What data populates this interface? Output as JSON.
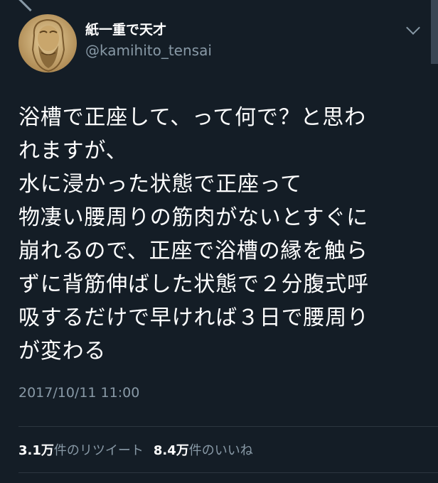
{
  "colors": {
    "background": "#141d26",
    "text_primary": "#ffffff",
    "text_secondary": "#8899a6",
    "divider": "#2c3640"
  },
  "icons": {
    "back": "chevron-left-icon",
    "more": "chevron-down-icon"
  },
  "tweet": {
    "display_name": "紙一重で天才",
    "handle": "@kamihito_tensai",
    "body_lines": [
      "浴槽で正座して、って何で？と思わ",
      "れますが、",
      "水に浸かった状態で正座って",
      "物凄い腰周りの筋肉がないとすぐに",
      "崩れるので、正座で浴槽の縁を触ら",
      "ずに背筋伸ばした状態で２分腹式呼",
      "吸するだけで早ければ３日で腰周り",
      "が変わる"
    ],
    "timestamp": "2017/10/11 11:00",
    "retweet_count": "3.1万",
    "retweet_label": "件のリツイート",
    "like_count": "8.4万",
    "like_label": "件のいいね"
  }
}
